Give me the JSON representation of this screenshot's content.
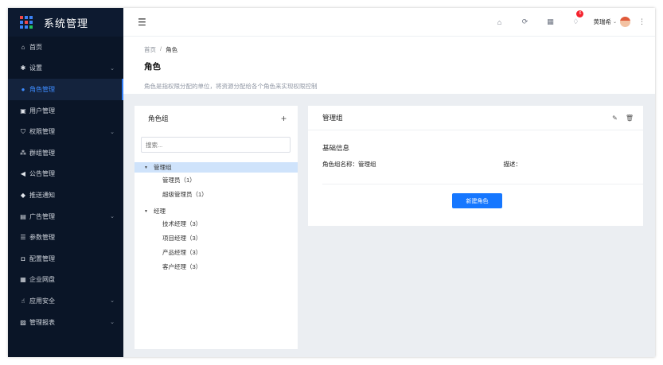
{
  "app": {
    "title": "系统管理"
  },
  "colors": {
    "sidebar_bg": "#0a1527",
    "accent": "#1677ff",
    "selected_node_bg": "#cfe3fb"
  },
  "sidebar": {
    "items": [
      {
        "label": "首页",
        "icon": "home-icon",
        "glyph": "⌂",
        "chevron": ""
      },
      {
        "label": "设置",
        "icon": "gear-icon",
        "glyph": "✱",
        "chevron": "⌄"
      },
      {
        "label": "角色管理",
        "icon": "user-circle-icon",
        "glyph": "●",
        "chevron": "",
        "active": true
      },
      {
        "label": "用户管理",
        "icon": "user-card-icon",
        "glyph": "▣",
        "chevron": ""
      },
      {
        "label": "权限管理",
        "icon": "shield-icon",
        "glyph": "⛉",
        "chevron": "⌄"
      },
      {
        "label": "群组管理",
        "icon": "group-icon",
        "glyph": "⁂",
        "chevron": ""
      },
      {
        "label": "公告管理",
        "icon": "megaphone-icon",
        "glyph": "◀",
        "chevron": ""
      },
      {
        "label": "推送通知",
        "icon": "bell-icon",
        "glyph": "◆",
        "chevron": ""
      },
      {
        "label": "广告管理",
        "icon": "image-icon",
        "glyph": "▤",
        "chevron": "⌄"
      },
      {
        "label": "参数管理",
        "icon": "server-icon",
        "glyph": "☰",
        "chevron": ""
      },
      {
        "label": "配置管理",
        "icon": "config-icon",
        "glyph": "◘",
        "chevron": ""
      },
      {
        "label": "企业网盘",
        "icon": "grid-icon",
        "glyph": "▦",
        "chevron": ""
      },
      {
        "label": "应用安全",
        "icon": "touch-icon",
        "glyph": "☝",
        "chevron": "⌄"
      },
      {
        "label": "管理报表",
        "icon": "chart-icon",
        "glyph": "▨",
        "chevron": "⌄"
      }
    ]
  },
  "topbar": {
    "notification_count": "6",
    "username": "黄瑞希"
  },
  "breadcrumb": {
    "home": "首页",
    "sep": "/",
    "current": "角色"
  },
  "page": {
    "title": "角色",
    "description": "角色是指权限分配的单位，将资源分配给各个角色来实现权限控制"
  },
  "role_groups": {
    "title": "角色组",
    "search_placeholder": "搜索...",
    "tree": [
      {
        "label": "管理组",
        "selected": true,
        "children": [
          "管理员（1）",
          "超级管理员（1）"
        ]
      },
      {
        "label": "经理",
        "selected": false,
        "children": [
          "技术经理（3）",
          "项目经理（3）",
          "产品经理（3）",
          "客户经理（3）"
        ]
      }
    ]
  },
  "detail": {
    "title": "管理组",
    "section_title": "基础信息",
    "name_label": "角色组名称：",
    "name_value": "管理组",
    "desc_label": "描述：",
    "new_role_button": "新建角色"
  }
}
